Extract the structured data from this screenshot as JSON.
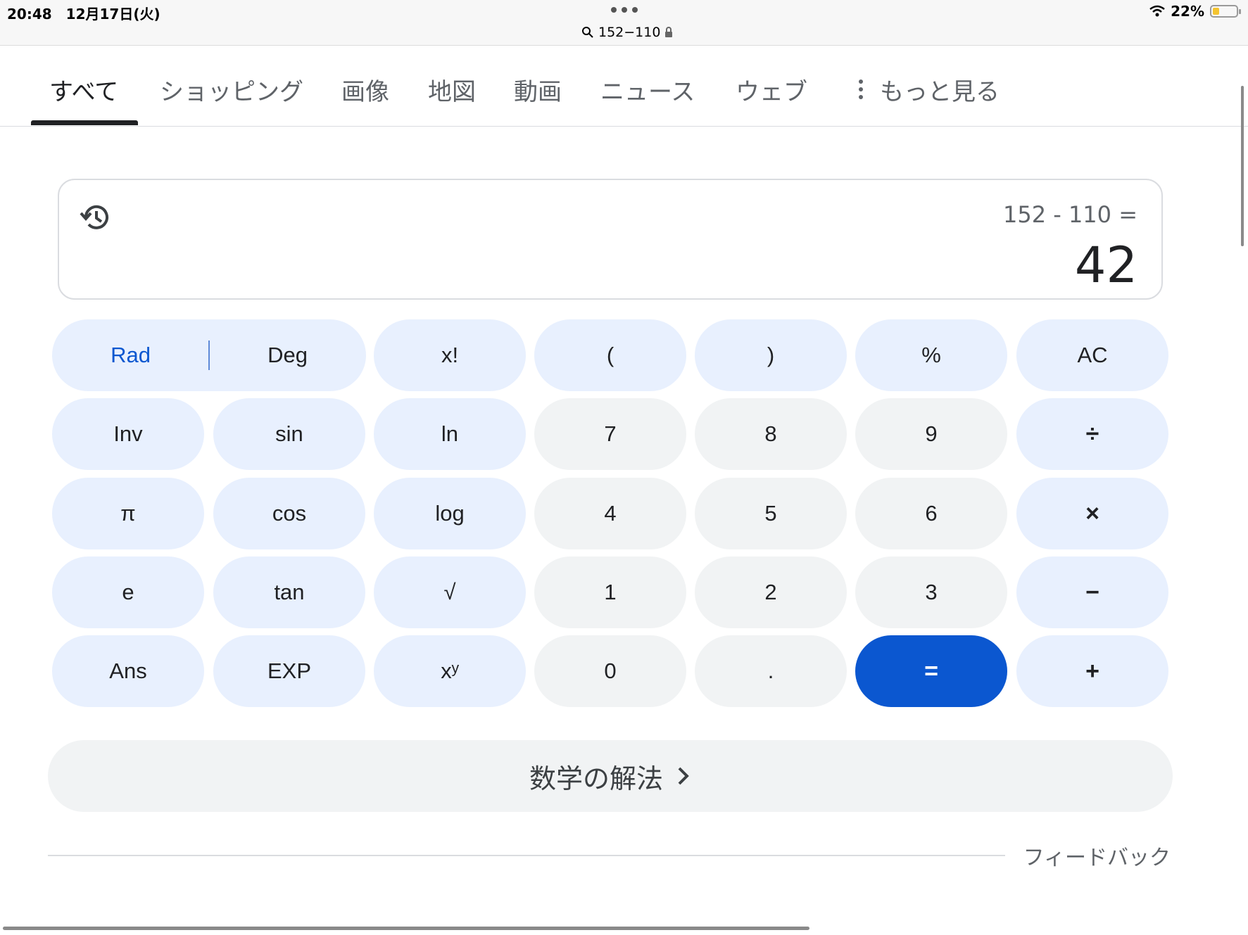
{
  "status_bar": {
    "time_date": "20:48　12月17日(火)",
    "url": "152−110",
    "battery": "22%",
    "battery_level": 0.22
  },
  "tabs": [
    {
      "label": "すべて",
      "active": true
    },
    {
      "label": "ショッピング"
    },
    {
      "label": "画像"
    },
    {
      "label": "地図"
    },
    {
      "label": "動画"
    },
    {
      "label": "ニュース"
    },
    {
      "label": "ウェブ"
    },
    {
      "label": "もっと見る"
    }
  ],
  "calculator": {
    "expression": "152 - 110 =",
    "result": "42",
    "rows": [
      [
        "Rad",
        "Deg",
        "x!",
        "(",
        ")",
        "%",
        "AC"
      ],
      [
        "Inv",
        "sin",
        "ln",
        "7",
        "8",
        "9",
        "÷"
      ],
      [
        "π",
        "cos",
        "log",
        "4",
        "5",
        "6",
        "×"
      ],
      [
        "e",
        "tan",
        "√",
        "1",
        "2",
        "3",
        "−"
      ],
      [
        "Ans",
        "EXP",
        "xʸ",
        "0",
        ".",
        "=",
        "+"
      ]
    ],
    "accent_color": "#0b57d0"
  },
  "solve": {
    "label": "数学の解法"
  },
  "feedback": "フィードバック"
}
